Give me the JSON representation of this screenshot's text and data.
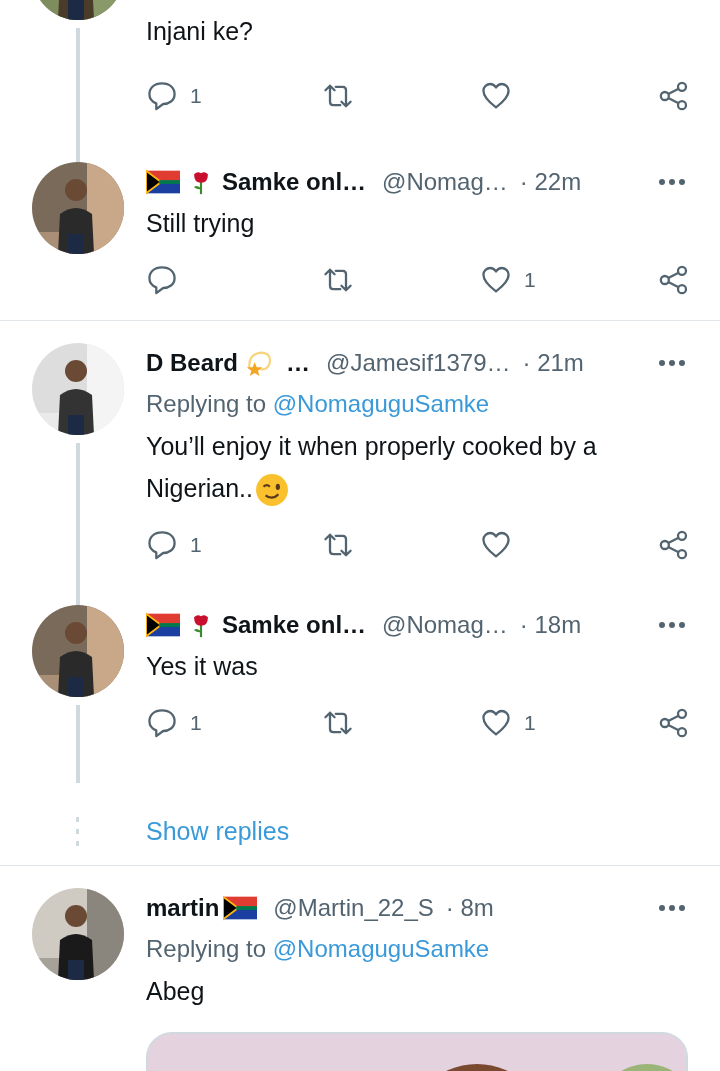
{
  "sections": [
    {
      "tweets": [
        {
          "avatar": {
            "kind": "picture"
          },
          "body": "Injani ke?",
          "connected": true,
          "actions": {
            "replies": "1"
          }
        },
        {
          "avatar": {
            "kind": "picture"
          },
          "name_emoji_before": [
            {
              "kind": "flag"
            },
            {
              "kind": "rose"
            }
          ],
          "name": "Samke onl…",
          "handle": "@Nomag…",
          "time": "· 22m",
          "body": "Still trying",
          "connected": false,
          "actions": {
            "likes": "1"
          }
        }
      ]
    },
    {
      "tweets": [
        {
          "avatar": {
            "kind": "picture"
          },
          "name": "D Beard",
          "name_emoji_after": [
            {
              "kind": "star"
            }
          ],
          "name_tail": "…",
          "handle": "@Jamesif1379…",
          "time": "· 21m",
          "replying_label": "Replying to",
          "replying_to": "@NomaguguSamke",
          "body": "You’ll enjoy it when properly cooked by a Nigerian..",
          "body_emoji": [
            {
              "kind": "wink"
            }
          ],
          "connected": true,
          "actions": {
            "replies": "1"
          }
        },
        {
          "avatar": {
            "kind": "picture"
          },
          "name_emoji_before": [
            {
              "kind": "flag"
            },
            {
              "kind": "rose"
            }
          ],
          "name": "Samke onl…",
          "handle": "@Nomag…",
          "time": "· 18m",
          "body": "Yes it was",
          "connected": true,
          "actions": {
            "replies": "1",
            "likes": "1"
          }
        }
      ],
      "show_replies": "Show replies"
    },
    {
      "tweets": [
        {
          "avatar": {
            "kind": "picture"
          },
          "name": "martin",
          "name_emoji_after": [
            {
              "kind": "flag"
            }
          ],
          "handle": "@Martin_22_S",
          "time": "· 8m",
          "replying_label": "Replying to",
          "replying_to": "@NomaguguSamke",
          "body": "Abeg",
          "media": {
            "kind": "picture"
          },
          "connected": false
        }
      ]
    }
  ]
}
